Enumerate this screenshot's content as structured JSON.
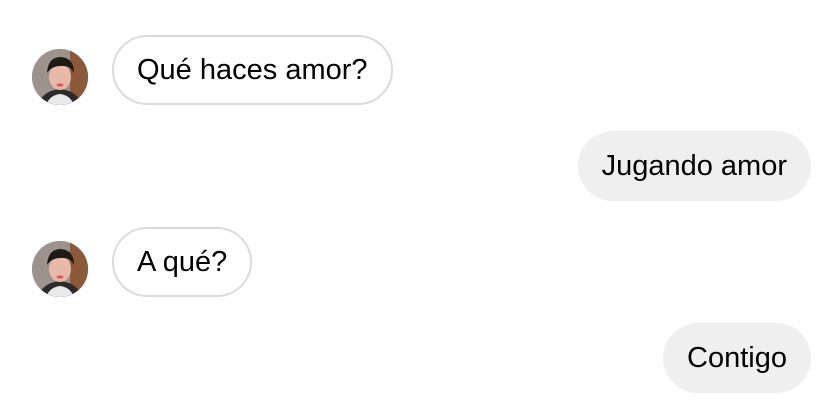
{
  "conversation": {
    "messages": [
      {
        "direction": "incoming",
        "text": "Qué haces amor?",
        "avatar_icon": "contact-avatar"
      },
      {
        "direction": "outgoing",
        "text": "Jugando amor"
      },
      {
        "direction": "incoming",
        "text": "A qué?",
        "avatar_icon": "contact-avatar"
      },
      {
        "direction": "outgoing",
        "text": "Contigo"
      }
    ]
  },
  "colors": {
    "background": "#ffffff",
    "incoming_border": "#dbdbdb",
    "outgoing_fill": "#efefef",
    "text": "#000000"
  }
}
